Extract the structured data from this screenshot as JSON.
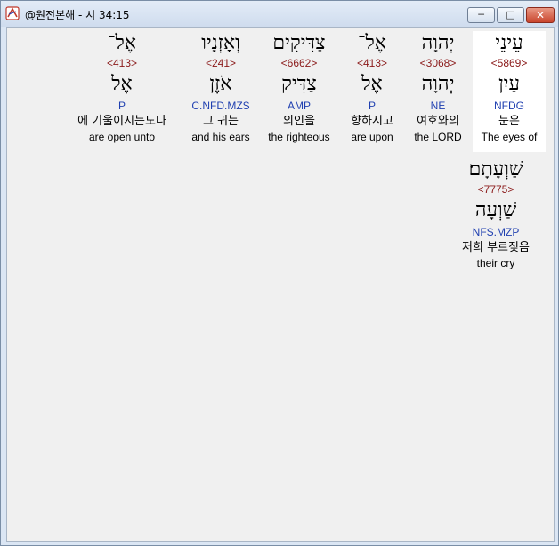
{
  "window": {
    "title": "@원전본해 - 시 34:15"
  },
  "words": [
    {
      "hebrew": "עֵינֵי",
      "strong": "<5869>",
      "lemma": "עַיִן",
      "morph": "NFDG",
      "korean": "눈은",
      "english": "The eyes of",
      "selected": true
    },
    {
      "hebrew": "יְהוָה",
      "strong": "<3068>",
      "lemma": "יְהוָה",
      "morph": "NE",
      "korean": "여호와의",
      "english": "the LORD",
      "selected": false
    },
    {
      "hebrew": "אֶל־",
      "strong": "<413>",
      "lemma": "אֶל",
      "morph": "P",
      "korean": "향하시고",
      "english": "are upon",
      "selected": false
    },
    {
      "hebrew": "צַדִּיקִים",
      "strong": "<6662>",
      "lemma": "צַדִּיק",
      "morph": "AMP",
      "korean": "의인을",
      "english": "the righteous",
      "selected": false
    },
    {
      "hebrew": "וְאָזְנָיו",
      "strong": "<241>",
      "lemma": "אֹזֶן",
      "morph": "C.NFD.MZS",
      "korean": "그 귀는",
      "english": "and his ears",
      "selected": false
    },
    {
      "hebrew": "אֶל־",
      "strong": "<413>",
      "lemma": "אֶל",
      "morph": "P",
      "korean": "에 기울이시는도다",
      "english": "are open unto",
      "selected": false
    },
    {
      "hebrew": "שַׁוְעָתָם׃",
      "strong": "<7775>",
      "lemma": "שַׁוְעָה",
      "morph": "NFS.MZP",
      "korean": "저희 부르짖음",
      "english": "their cry",
      "selected": false
    }
  ]
}
